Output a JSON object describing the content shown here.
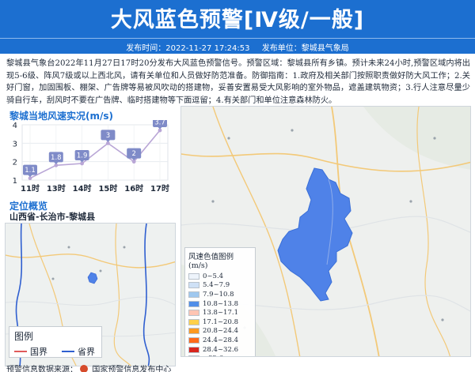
{
  "header": {
    "title": "大风蓝色预警[Ⅳ级/一般]",
    "publish_time_label": "发布时间：2022-11-27 17:24:53",
    "publisher_label": "发布单位：黎城县气象局"
  },
  "notice": {
    "text": "黎城县气象台2022年11月27日17时20分发布大风蓝色预警信号。预警区域：黎城县所有乡镇。预计未来24小时,预警区域内将出现5-6级、阵风7级或以上西北风，请有关单位和人员做好防范准备。防御指南：1.政府及相关部门按照职责做好防大风工作；2.关好门窗，加固围板、棚架、广告牌等易被风吹动的搭建物，妥善安置易受大风影响的室外物品，遮盖建筑物资；3.行人注意尽量少骑自行车，刮风时不要在广告牌、临时搭建物等下面逗留；4.有关部门和单位注意森林防火。"
  },
  "chart_data": {
    "type": "line",
    "title": "黎城当地风速实况(m/s)",
    "categories": [
      "11时",
      "13时",
      "14时",
      "15时",
      "16时",
      "17时"
    ],
    "values": [
      1.1,
      1.8,
      1.9,
      3,
      2,
      3.7
    ],
    "data_labels": [
      "1.1",
      "1.8",
      "1.9",
      "3",
      "2",
      "3.7"
    ],
    "y_ticks": [
      "1",
      "2",
      "3",
      "4"
    ],
    "ylim": [
      1,
      4
    ],
    "grid": true,
    "line_color": "#b9a6d6",
    "label_color": "#7f8bc8"
  },
  "location": {
    "title": "定位概览",
    "region": "山西省-长治市-黎城县",
    "legend_title": "图例",
    "legend_items": [
      {
        "label": "国界",
        "color": "#e05a5a"
      },
      {
        "label": "省界",
        "color": "#2f5fd0"
      }
    ]
  },
  "wind_legend": {
    "title": "风速色值图例 (m/s)",
    "items": [
      {
        "label": "0~5.4",
        "color": "#eef4fb"
      },
      {
        "label": "5.4~7.9",
        "color": "#cfe1f6"
      },
      {
        "label": "7.9~10.8",
        "color": "#9fc8ef"
      },
      {
        "label": "10.8~13.8",
        "color": "#4f8ee8"
      },
      {
        "label": "13.8~17.1",
        "color": "#ffc5b3"
      },
      {
        "label": "17.1~20.8",
        "color": "#ffd04a"
      },
      {
        "label": "20.8~24.4",
        "color": "#ff9a22"
      },
      {
        "label": "24.4~28.4",
        "color": "#ff6a1a"
      },
      {
        "label": "28.4~32.6",
        "color": "#d8261e"
      },
      {
        "label": ">32.6",
        "color": "#9c1414"
      }
    ]
  },
  "footer": {
    "source_prefix": "预警信息数据来源：",
    "source_name": "国家预警信息发布中心"
  },
  "colors": {
    "header_bg": "#1c6fd0",
    "panel_title": "#1c6fd0",
    "warning_area": "#4f82e8"
  }
}
